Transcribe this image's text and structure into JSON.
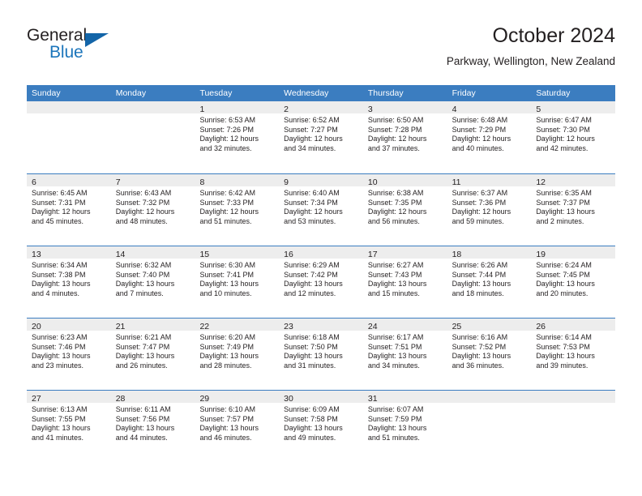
{
  "brand": {
    "word_one": "General",
    "word_two": "Blue",
    "triangle_icon": "triangle-icon"
  },
  "header": {
    "title": "October 2024",
    "subtitle": "Parkway, Wellington, New Zealand"
  },
  "colors": {
    "header_blue": "#3b7dc0",
    "datebar_gray": "#ededed",
    "text": "#231f20",
    "brand_blue": "#1b75bb",
    "triangle_blue": "#1365a8"
  },
  "calendar": {
    "day_headers": [
      "Sunday",
      "Monday",
      "Tuesday",
      "Wednesday",
      "Thursday",
      "Friday",
      "Saturday"
    ],
    "weeks": [
      [
        {
          "date": "",
          "lines": []
        },
        {
          "date": "",
          "lines": []
        },
        {
          "date": "1",
          "lines": [
            "Sunrise: 6:53 AM",
            "Sunset: 7:26 PM",
            "Daylight: 12 hours",
            "and 32 minutes."
          ]
        },
        {
          "date": "2",
          "lines": [
            "Sunrise: 6:52 AM",
            "Sunset: 7:27 PM",
            "Daylight: 12 hours",
            "and 34 minutes."
          ]
        },
        {
          "date": "3",
          "lines": [
            "Sunrise: 6:50 AM",
            "Sunset: 7:28 PM",
            "Daylight: 12 hours",
            "and 37 minutes."
          ]
        },
        {
          "date": "4",
          "lines": [
            "Sunrise: 6:48 AM",
            "Sunset: 7:29 PM",
            "Daylight: 12 hours",
            "and 40 minutes."
          ]
        },
        {
          "date": "5",
          "lines": [
            "Sunrise: 6:47 AM",
            "Sunset: 7:30 PM",
            "Daylight: 12 hours",
            "and 42 minutes."
          ]
        }
      ],
      [
        {
          "date": "6",
          "lines": [
            "Sunrise: 6:45 AM",
            "Sunset: 7:31 PM",
            "Daylight: 12 hours",
            "and 45 minutes."
          ]
        },
        {
          "date": "7",
          "lines": [
            "Sunrise: 6:43 AM",
            "Sunset: 7:32 PM",
            "Daylight: 12 hours",
            "and 48 minutes."
          ]
        },
        {
          "date": "8",
          "lines": [
            "Sunrise: 6:42 AM",
            "Sunset: 7:33 PM",
            "Daylight: 12 hours",
            "and 51 minutes."
          ]
        },
        {
          "date": "9",
          "lines": [
            "Sunrise: 6:40 AM",
            "Sunset: 7:34 PM",
            "Daylight: 12 hours",
            "and 53 minutes."
          ]
        },
        {
          "date": "10",
          "lines": [
            "Sunrise: 6:38 AM",
            "Sunset: 7:35 PM",
            "Daylight: 12 hours",
            "and 56 minutes."
          ]
        },
        {
          "date": "11",
          "lines": [
            "Sunrise: 6:37 AM",
            "Sunset: 7:36 PM",
            "Daylight: 12 hours",
            "and 59 minutes."
          ]
        },
        {
          "date": "12",
          "lines": [
            "Sunrise: 6:35 AM",
            "Sunset: 7:37 PM",
            "Daylight: 13 hours",
            "and 2 minutes."
          ]
        }
      ],
      [
        {
          "date": "13",
          "lines": [
            "Sunrise: 6:34 AM",
            "Sunset: 7:38 PM",
            "Daylight: 13 hours",
            "and 4 minutes."
          ]
        },
        {
          "date": "14",
          "lines": [
            "Sunrise: 6:32 AM",
            "Sunset: 7:40 PM",
            "Daylight: 13 hours",
            "and 7 minutes."
          ]
        },
        {
          "date": "15",
          "lines": [
            "Sunrise: 6:30 AM",
            "Sunset: 7:41 PM",
            "Daylight: 13 hours",
            "and 10 minutes."
          ]
        },
        {
          "date": "16",
          "lines": [
            "Sunrise: 6:29 AM",
            "Sunset: 7:42 PM",
            "Daylight: 13 hours",
            "and 12 minutes."
          ]
        },
        {
          "date": "17",
          "lines": [
            "Sunrise: 6:27 AM",
            "Sunset: 7:43 PM",
            "Daylight: 13 hours",
            "and 15 minutes."
          ]
        },
        {
          "date": "18",
          "lines": [
            "Sunrise: 6:26 AM",
            "Sunset: 7:44 PM",
            "Daylight: 13 hours",
            "and 18 minutes."
          ]
        },
        {
          "date": "19",
          "lines": [
            "Sunrise: 6:24 AM",
            "Sunset: 7:45 PM",
            "Daylight: 13 hours",
            "and 20 minutes."
          ]
        }
      ],
      [
        {
          "date": "20",
          "lines": [
            "Sunrise: 6:23 AM",
            "Sunset: 7:46 PM",
            "Daylight: 13 hours",
            "and 23 minutes."
          ]
        },
        {
          "date": "21",
          "lines": [
            "Sunrise: 6:21 AM",
            "Sunset: 7:47 PM",
            "Daylight: 13 hours",
            "and 26 minutes."
          ]
        },
        {
          "date": "22",
          "lines": [
            "Sunrise: 6:20 AM",
            "Sunset: 7:49 PM",
            "Daylight: 13 hours",
            "and 28 minutes."
          ]
        },
        {
          "date": "23",
          "lines": [
            "Sunrise: 6:18 AM",
            "Sunset: 7:50 PM",
            "Daylight: 13 hours",
            "and 31 minutes."
          ]
        },
        {
          "date": "24",
          "lines": [
            "Sunrise: 6:17 AM",
            "Sunset: 7:51 PM",
            "Daylight: 13 hours",
            "and 34 minutes."
          ]
        },
        {
          "date": "25",
          "lines": [
            "Sunrise: 6:16 AM",
            "Sunset: 7:52 PM",
            "Daylight: 13 hours",
            "and 36 minutes."
          ]
        },
        {
          "date": "26",
          "lines": [
            "Sunrise: 6:14 AM",
            "Sunset: 7:53 PM",
            "Daylight: 13 hours",
            "and 39 minutes."
          ]
        }
      ],
      [
        {
          "date": "27",
          "lines": [
            "Sunrise: 6:13 AM",
            "Sunset: 7:55 PM",
            "Daylight: 13 hours",
            "and 41 minutes."
          ]
        },
        {
          "date": "28",
          "lines": [
            "Sunrise: 6:11 AM",
            "Sunset: 7:56 PM",
            "Daylight: 13 hours",
            "and 44 minutes."
          ]
        },
        {
          "date": "29",
          "lines": [
            "Sunrise: 6:10 AM",
            "Sunset: 7:57 PM",
            "Daylight: 13 hours",
            "and 46 minutes."
          ]
        },
        {
          "date": "30",
          "lines": [
            "Sunrise: 6:09 AM",
            "Sunset: 7:58 PM",
            "Daylight: 13 hours",
            "and 49 minutes."
          ]
        },
        {
          "date": "31",
          "lines": [
            "Sunrise: 6:07 AM",
            "Sunset: 7:59 PM",
            "Daylight: 13 hours",
            "and 51 minutes."
          ]
        },
        {
          "date": "",
          "lines": []
        },
        {
          "date": "",
          "lines": []
        }
      ]
    ]
  }
}
